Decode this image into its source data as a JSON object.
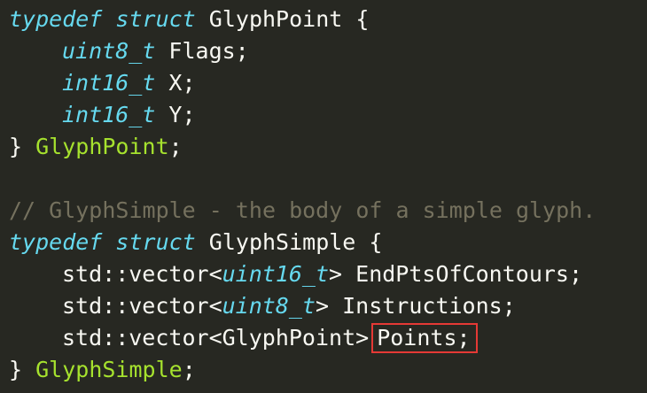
{
  "code": {
    "lines": [
      {
        "parts": [
          "typedef",
          "struct",
          "GlyphPoint {"
        ]
      },
      {
        "parts": [
          "uint8_t",
          "Flags;"
        ]
      },
      {
        "parts": [
          "int16_t",
          "X;"
        ]
      },
      {
        "parts": [
          "int16_t",
          "Y;"
        ]
      },
      {
        "parts": [
          "}",
          "GlyphPoint",
          ";"
        ]
      },
      {
        "parts": []
      },
      {
        "parts": [
          "// GlyphSimple - the body of a simple glyph."
        ]
      },
      {
        "parts": [
          "typedef",
          "struct",
          "GlyphSimple {"
        ]
      },
      {
        "parts": [
          "std::vector<",
          "uint16_t",
          "> EndPtsOfContours;"
        ]
      },
      {
        "parts": [
          "std::vector<",
          "uint8_t",
          "> Instructions;"
        ]
      },
      {
        "parts": [
          "std::vector<GlyphPoint>",
          "Points;"
        ]
      },
      {
        "parts": [
          "}",
          "GlyphSimple",
          ";"
        ]
      }
    ]
  },
  "highlight": {
    "color": "#e53935",
    "text": "Points;"
  },
  "colors": {
    "background": "#272822",
    "keyword": "#66d9ef",
    "type_name": "#a6e22e",
    "comment": "#75715e",
    "text": "#f8f8f2"
  }
}
